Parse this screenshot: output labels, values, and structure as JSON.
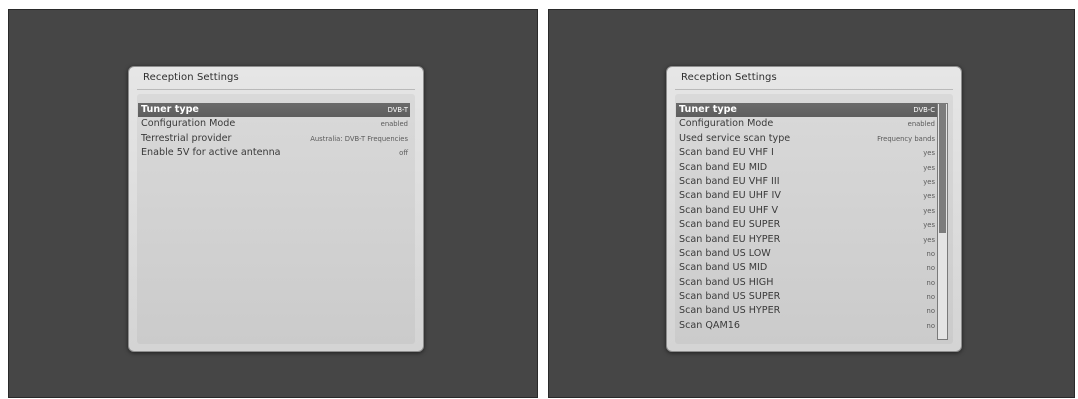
{
  "screens": [
    {
      "panel_title": "Reception Settings",
      "rows": [
        {
          "label": "Tuner type",
          "value": "DVB-T"
        },
        {
          "label": "Configuration Mode",
          "value": "enabled"
        },
        {
          "label": "Terrestrial provider",
          "value": "Australia: DVB-T Frequencies"
        },
        {
          "label": "Enable 5V for active antenna",
          "value": "off"
        }
      ],
      "selected_index": 0
    },
    {
      "panel_title": "Reception Settings",
      "rows": [
        {
          "label": "Tuner type",
          "value": "DVB-C"
        },
        {
          "label": "Configuration Mode",
          "value": "enabled"
        },
        {
          "label": "Used service scan type",
          "value": "Frequency bands"
        },
        {
          "label": "Scan band EU VHF I",
          "value": "yes"
        },
        {
          "label": "Scan band EU MID",
          "value": "yes"
        },
        {
          "label": "Scan band EU VHF III",
          "value": "yes"
        },
        {
          "label": "Scan band EU UHF IV",
          "value": "yes"
        },
        {
          "label": "Scan band EU UHF V",
          "value": "yes"
        },
        {
          "label": "Scan band EU SUPER",
          "value": "yes"
        },
        {
          "label": "Scan band EU HYPER",
          "value": "yes"
        },
        {
          "label": "Scan band US LOW",
          "value": "no"
        },
        {
          "label": "Scan band US MID",
          "value": "no"
        },
        {
          "label": "Scan band US HIGH",
          "value": "no"
        },
        {
          "label": "Scan band US SUPER",
          "value": "no"
        },
        {
          "label": "Scan band US HYPER",
          "value": "no"
        },
        {
          "label": "Scan QAM16",
          "value": "no"
        }
      ],
      "selected_index": 0,
      "scroll_fraction_visible": 0.55
    }
  ]
}
